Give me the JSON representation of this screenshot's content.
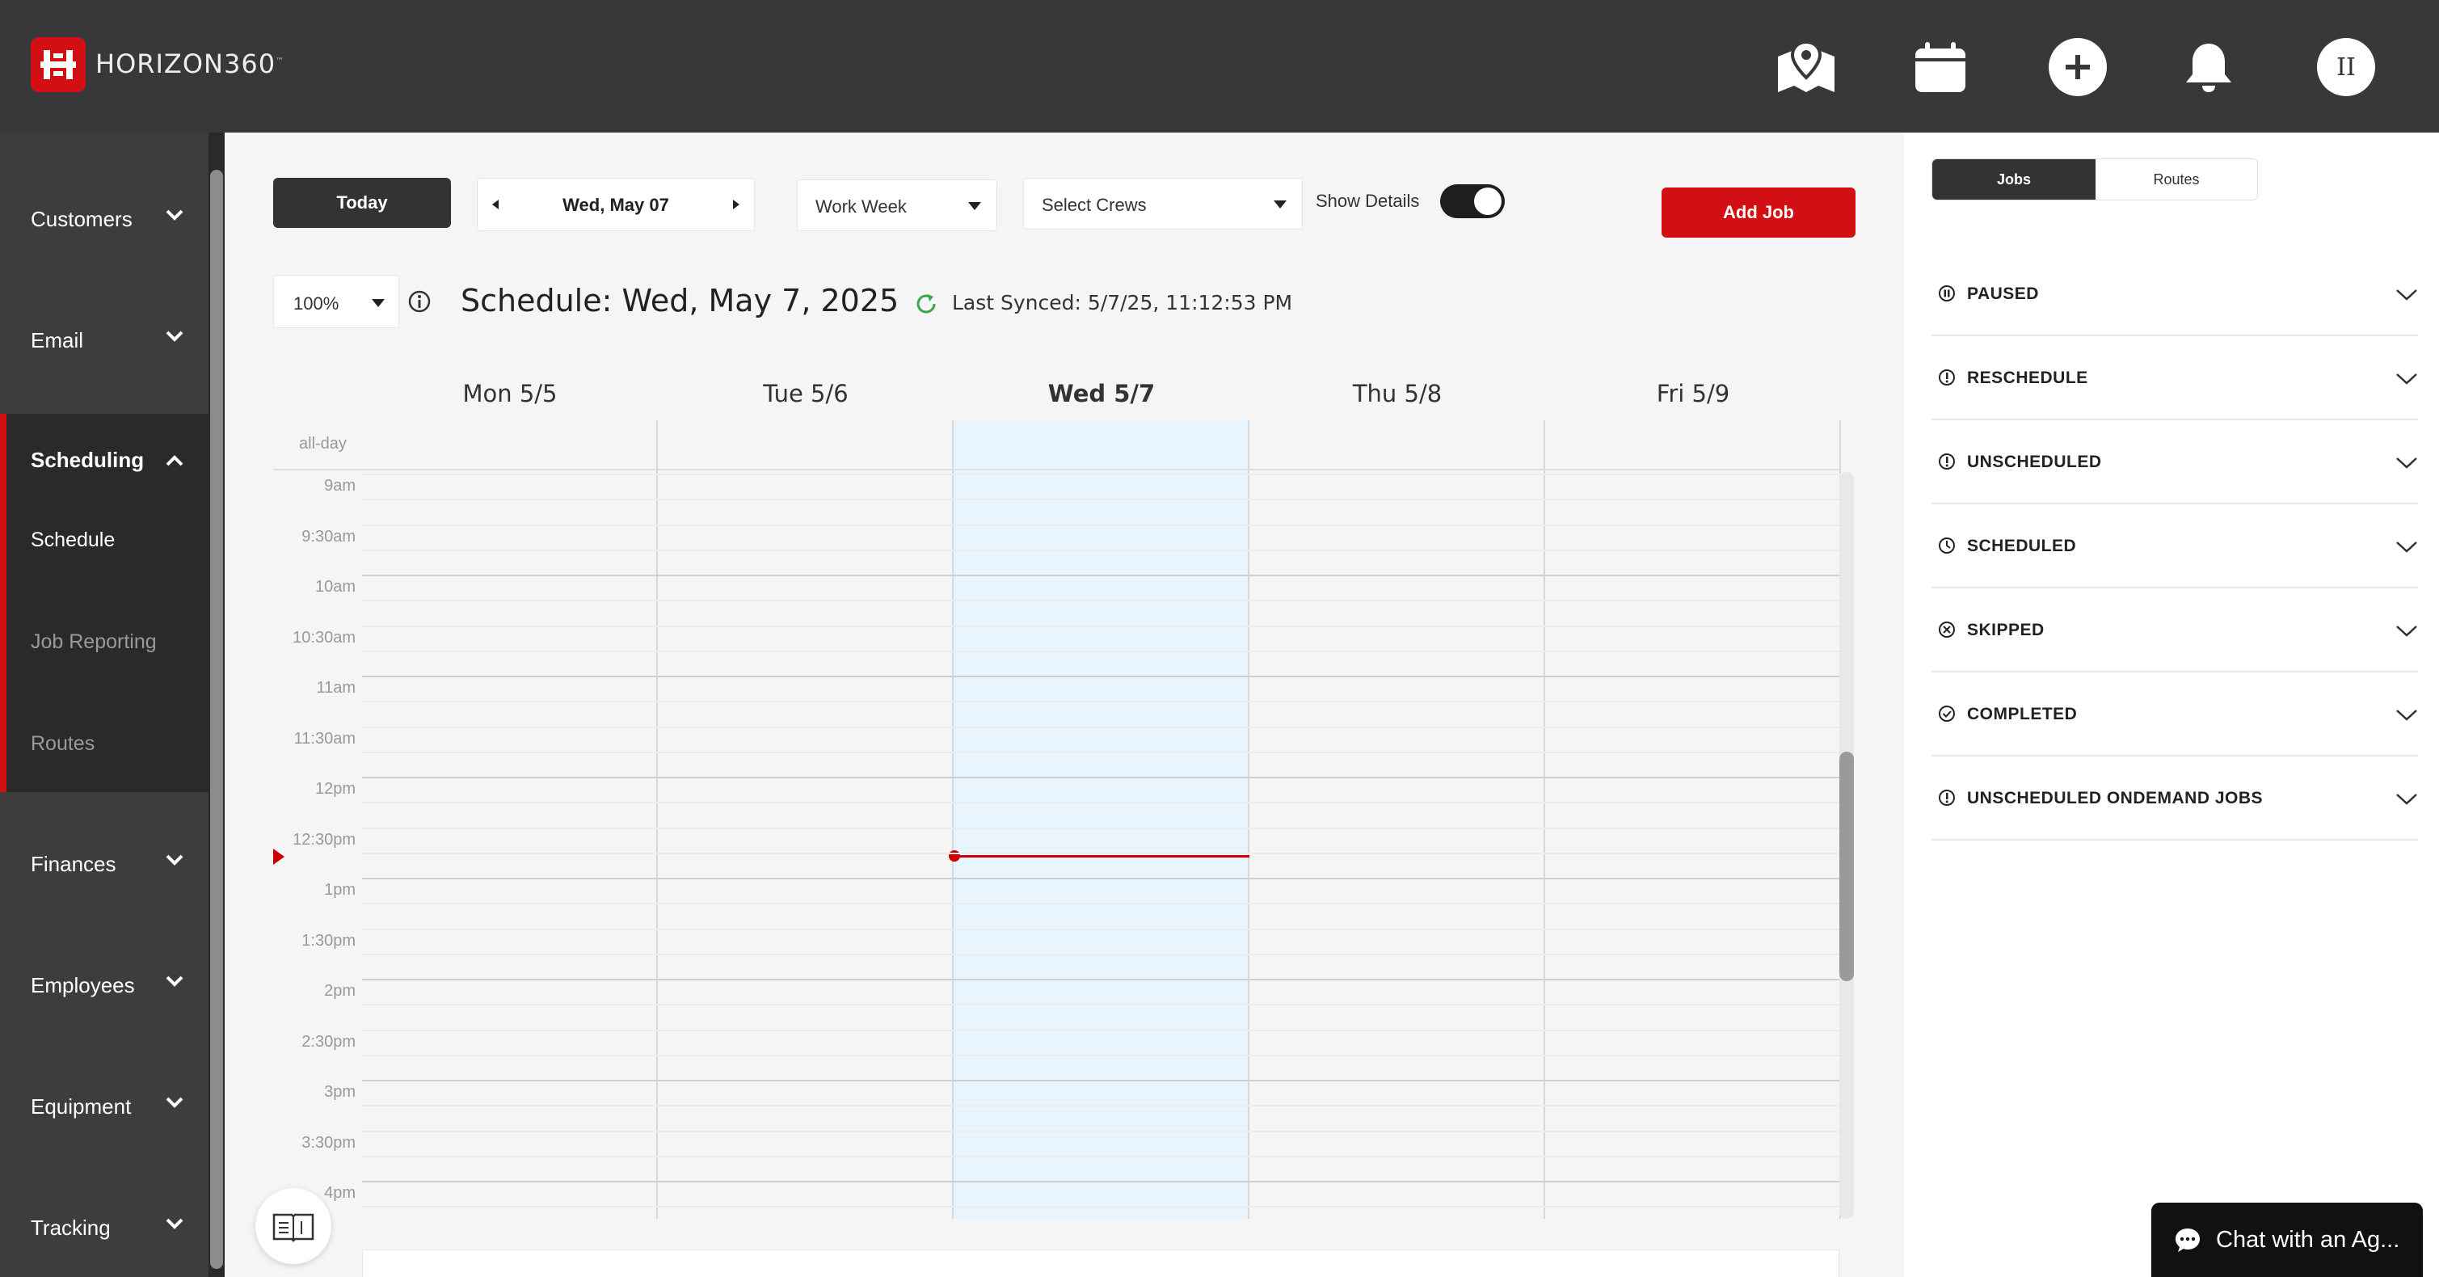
{
  "header": {
    "logo_text": "HORIZON360",
    "logo_tm": "™",
    "icons": [
      "map-pin-icon",
      "calendar-icon",
      "plus-circle-icon",
      "bell-icon"
    ],
    "avatar_initials": "II"
  },
  "sidebar": {
    "items_top": [
      {
        "label": "Customers"
      },
      {
        "label": "Email"
      }
    ],
    "scheduling": {
      "label": "Scheduling",
      "sub": [
        {
          "label": "Schedule",
          "active": true
        },
        {
          "label": "Job Reporting",
          "active": false
        },
        {
          "label": "Routes",
          "active": false
        }
      ]
    },
    "items_bottom": [
      {
        "label": "Finances"
      },
      {
        "label": "Employees"
      },
      {
        "label": "Equipment"
      },
      {
        "label": "Tracking"
      }
    ]
  },
  "toolbar": {
    "today_label": "Today",
    "date_label": "Wed, May 07",
    "view_value": "Work Week",
    "crew_placeholder": "Select Crews",
    "show_details_label": "Show Details",
    "show_details_on": true,
    "add_job_label": "Add Job",
    "zoom_value": "100%"
  },
  "schedule": {
    "title": "Schedule: Wed, May 7, 2025",
    "synced_text": "Last Synced: 5/7/25, 11:12:53 PM",
    "days": [
      {
        "label": "Mon 5/5",
        "today": false
      },
      {
        "label": "Tue 5/6",
        "today": false
      },
      {
        "label": "Wed 5/7",
        "today": true
      },
      {
        "label": "Thu 5/8",
        "today": false
      },
      {
        "label": "Fri 5/9",
        "today": false
      }
    ],
    "allday_label": "all-day",
    "times": [
      "9am",
      "9:30am",
      "10am",
      "10:30am",
      "11am",
      "11:30am",
      "12pm",
      "12:30pm",
      "1pm",
      "1:30pm",
      "2pm",
      "2:30pm",
      "3pm",
      "3:30pm",
      "4pm"
    ]
  },
  "right_panel": {
    "tabs": [
      {
        "label": "Jobs",
        "active": true
      },
      {
        "label": "Routes",
        "active": false
      }
    ],
    "groups": [
      {
        "label": "PAUSED",
        "icon": "pause-circle-icon"
      },
      {
        "label": "RESCHEDULE",
        "icon": "alert-circle-icon"
      },
      {
        "label": "UNSCHEDULED",
        "icon": "alert-circle-icon"
      },
      {
        "label": "SCHEDULED",
        "icon": "clock-icon"
      },
      {
        "label": "SKIPPED",
        "icon": "x-circle-icon"
      },
      {
        "label": "COMPLETED",
        "icon": "check-circle-icon"
      },
      {
        "label": "UNSCHEDULED ONDEMAND JOBS",
        "icon": "alert-circle-icon"
      }
    ]
  },
  "chat": {
    "label": "Chat with an Ag..."
  },
  "colors": {
    "brand_red": "#d40f14",
    "header_bg": "#383838",
    "sidebar_bg": "#3d3d3d",
    "today_col": "#e8f4fe",
    "sync_green": "#3aa54a"
  }
}
